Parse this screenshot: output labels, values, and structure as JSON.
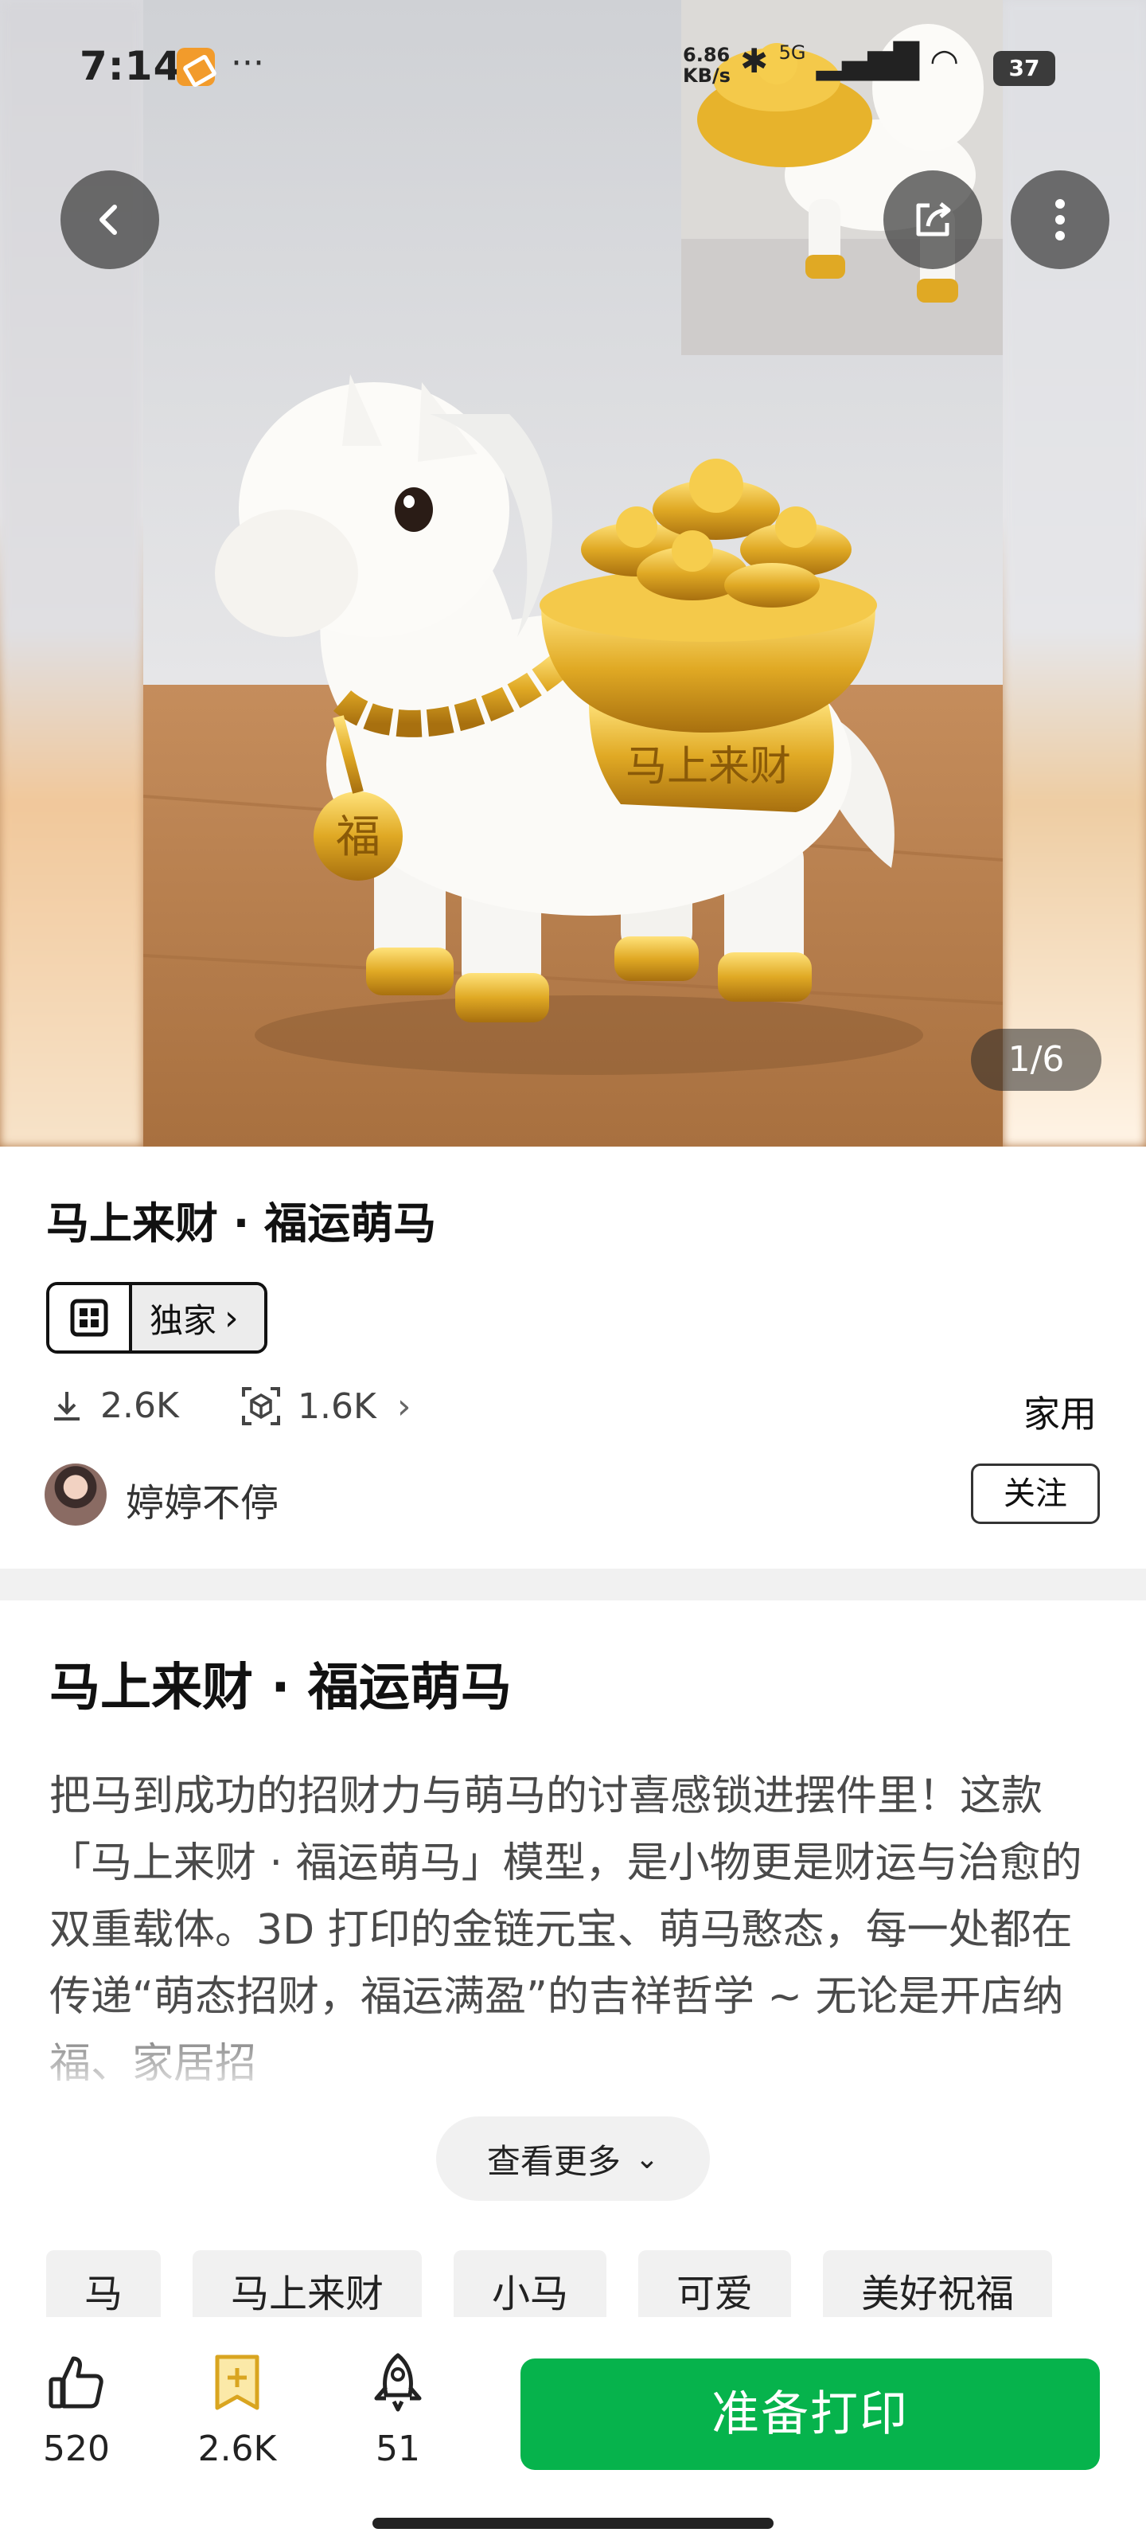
{
  "status_bar": {
    "time": "7:14",
    "dots": "···",
    "net_speed_value": "6.86",
    "net_speed_unit": "KB/s",
    "signal_label": "5G",
    "battery": "37"
  },
  "hero": {
    "page_counter": "1/6"
  },
  "model": {
    "title": "马上来财 · 福运萌马",
    "badge_label": "独家",
    "downloads": "2.6K",
    "makes": "1.6K",
    "category": "家用"
  },
  "author": {
    "name": "婷婷不停",
    "follow_label": "关注"
  },
  "description": {
    "title": "马上来财 · 福运萌马",
    "text": "把马到成功的招财力与萌马的讨喜感锁进摆件里！这款「马上来财 · 福运萌马」模型，是小物更是财运与治愈的双重载体。3D 打印的金链元宝、萌马憨态，每一处都在传递“萌态招财，福运满盈”的吉祥哲学 ~ 无论是开店纳福、家居招",
    "see_more_label": "查看更多"
  },
  "tags": [
    "马",
    "马上来财",
    "小马",
    "可爱",
    "美好祝福"
  ],
  "actions": {
    "likes": "520",
    "favorites": "2.6K",
    "boosts": "51",
    "print_label": "准备打印"
  },
  "colors": {
    "accent_green": "#06b34c",
    "gold": "#d9a520"
  }
}
